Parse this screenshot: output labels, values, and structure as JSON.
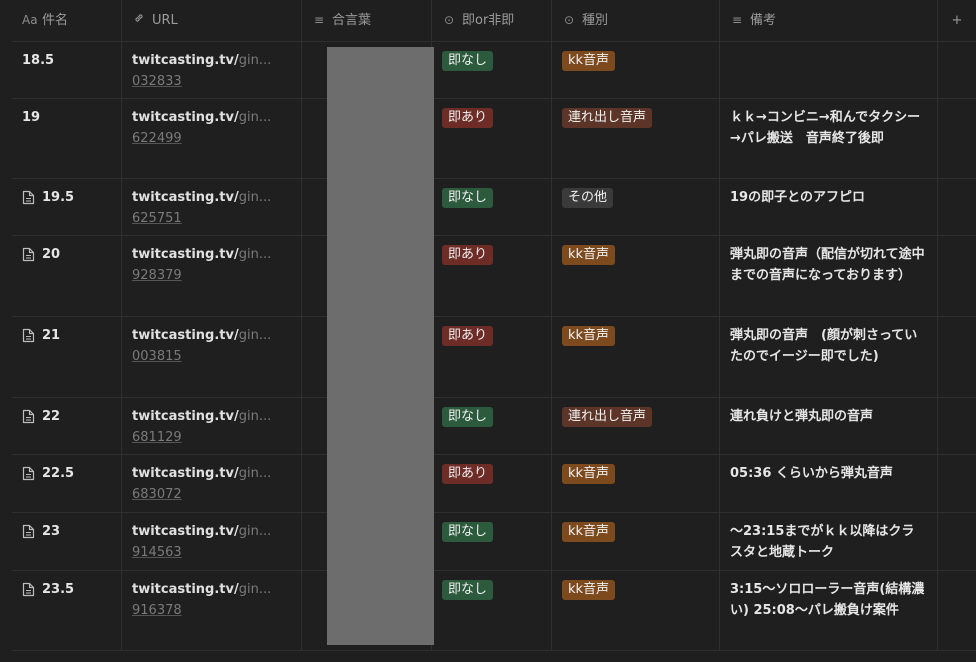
{
  "columns": [
    {
      "icon": "Aa",
      "label": "件名"
    },
    {
      "icon": "🔗",
      "label": "URL"
    },
    {
      "icon": "≡",
      "label": "合言葉"
    },
    {
      "icon": "⊙",
      "label": "即or非即"
    },
    {
      "icon": "⊙",
      "label": "種別"
    },
    {
      "icon": "≡",
      "label": "備考"
    },
    {
      "icon": "+",
      "label": ""
    }
  ],
  "tag_colors": {
    "即なし": "#2b5a3d",
    "即あり": "#6e2c27",
    "kk音声": "#7d4a1e",
    "連れ出し音声": "#5c3528",
    "その他": "#3a3a3a"
  },
  "rows": [
    {
      "name": "18.5",
      "doc": false,
      "url_main": "twitcasting.tv/",
      "url_dim": "gin...",
      "url_sub": "032833",
      "sokuhi": "即なし",
      "type": "kk音声",
      "note": ""
    },
    {
      "name": "19",
      "doc": false,
      "url_main": "twitcasting.tv/",
      "url_dim": "gin...",
      "url_sub": "622499",
      "sokuhi": "即あり",
      "type": "連れ出し音声",
      "note": "ｋｋ→コンビニ→和んでタクシー→パレ搬送　音声終了後即"
    },
    {
      "name": "19.5",
      "doc": true,
      "url_main": "twitcasting.tv/",
      "url_dim": "gin...",
      "url_sub": "625751",
      "sokuhi": "即なし",
      "type": "その他",
      "note": "19の即子とのアフピロ"
    },
    {
      "name": "20",
      "doc": true,
      "url_main": "twitcasting.tv/",
      "url_dim": "gin...",
      "url_sub": "928379",
      "sokuhi": "即あり",
      "type": "kk音声",
      "note": "弾丸即の音声（配信が切れて途中までの音声になっております）"
    },
    {
      "name": "21",
      "doc": true,
      "url_main": "twitcasting.tv/",
      "url_dim": "gin...",
      "url_sub": "003815",
      "sokuhi": "即あり",
      "type": "kk音声",
      "note": "弾丸即の音声　(顔が刺さっていたのでイージー即でした)"
    },
    {
      "name": "22",
      "doc": true,
      "url_main": "twitcasting.tv/",
      "url_dim": "gin...",
      "url_sub": "681129",
      "sokuhi": "即なし",
      "type": "連れ出し音声",
      "note": "連れ負けと弾丸即の音声"
    },
    {
      "name": "22.5",
      "doc": true,
      "url_main": "twitcasting.tv/",
      "url_dim": "gin...",
      "url_sub": "683072",
      "sokuhi": "即あり",
      "type": "kk音声",
      "note": "05:36 くらいから弾丸音声"
    },
    {
      "name": "23",
      "doc": true,
      "url_main": "twitcasting.tv/",
      "url_dim": "gin...",
      "url_sub": "914563",
      "sokuhi": "即なし",
      "type": "kk音声",
      "note": "〜23:15までがｋｋ以降はクラスタと地蔵トーク"
    },
    {
      "name": "23.5",
      "doc": true,
      "url_main": "twitcasting.tv/",
      "url_dim": "gin...",
      "url_sub": "916378",
      "sokuhi": "即なし",
      "type": "kk音声",
      "note": "3:15〜ソロローラー音声(結構濃い) 25:08〜パレ搬負け案件"
    }
  ]
}
